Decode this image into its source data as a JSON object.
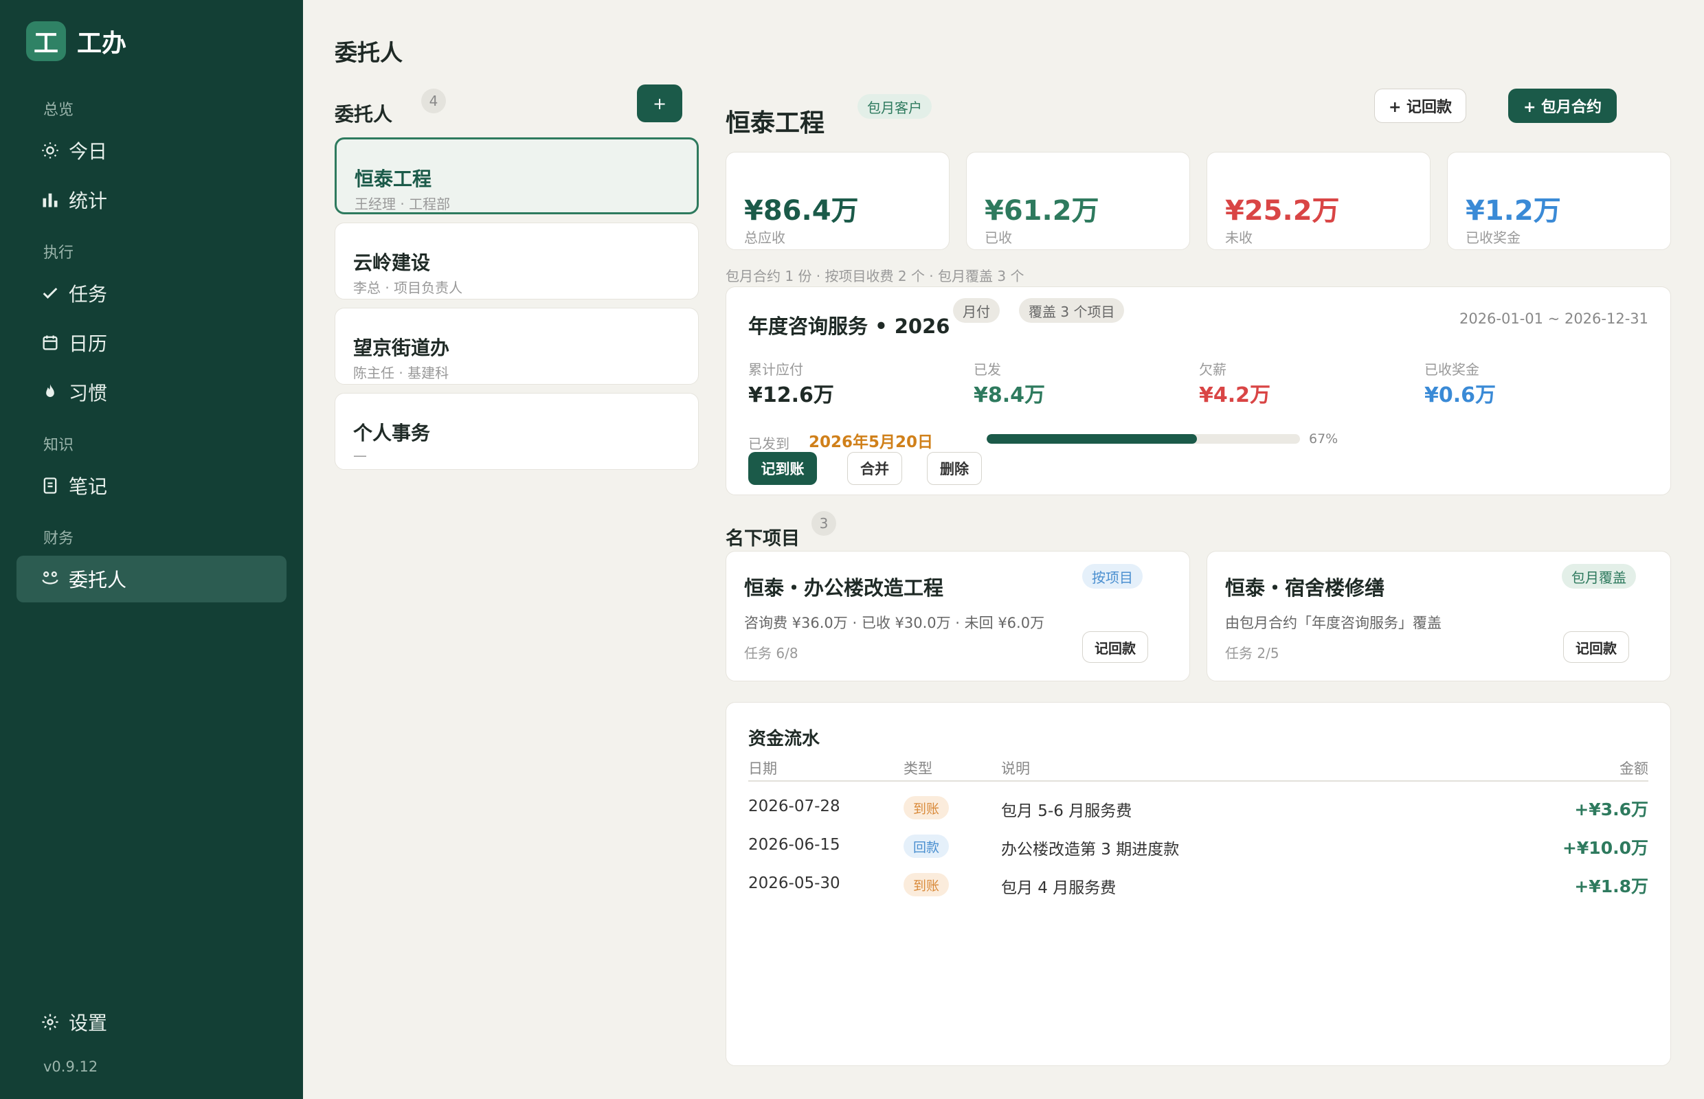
{
  "sidebar": {
    "brand_logo": "工",
    "brand_name": "工办",
    "sections": [
      "总览",
      "执行",
      "知识",
      "财务"
    ],
    "items": [
      {
        "label": "今日",
        "icon": "sun-icon"
      },
      {
        "label": "统计",
        "icon": "bar-chart-icon"
      },
      {
        "label": "任务",
        "icon": "check-icon"
      },
      {
        "label": "日历",
        "icon": "calendar-icon"
      },
      {
        "label": "习惯",
        "icon": "flame-icon"
      },
      {
        "label": "笔记",
        "icon": "note-icon"
      },
      {
        "label": "委托人",
        "icon": "people-icon",
        "active": true
      }
    ],
    "settings_label": "设置",
    "version": "v0.9.12"
  },
  "page_title": "委托人",
  "client_list": {
    "title": "委托人",
    "count": "4",
    "add_label": "+",
    "clients": [
      {
        "name": "恒泰工程",
        "sub": "王经理 · 工程部"
      },
      {
        "name": "云岭建设",
        "sub": "李总 · 项目负责人"
      },
      {
        "name": "望京街道办",
        "sub": "陈主任 · 基建科"
      },
      {
        "name": "个人事务",
        "sub": "—"
      }
    ]
  },
  "detail": {
    "name": "恒泰工程",
    "badge": "包月客户",
    "record_payment_label": "+ 记回款",
    "monthly_contract_label": "+ 包月合约",
    "stats": [
      {
        "value": "¥86.4万",
        "label": "总应收",
        "color": "#1b5a49"
      },
      {
        "value": "¥61.2万",
        "label": "已收",
        "color": "#2e7a5e"
      },
      {
        "value": "¥25.2万",
        "label": "未收",
        "color": "#d94545"
      },
      {
        "value": "¥1.2万",
        "label": "已收奖金",
        "color": "#3a8ad6"
      }
    ],
    "meta": "包月合约 1 份 · 按项目收费 2 个 · 包月覆盖 3 个"
  },
  "contract": {
    "title": "年度咨询服务 • 2026",
    "tag_monthly": "月付",
    "tag_coverage": "覆盖 3 个项目",
    "date_range": "2026-01-01 ~ 2026-12-31",
    "stats": [
      {
        "label": "累计应付",
        "value": "¥12.6万",
        "color": "#1f2a26"
      },
      {
        "label": "已发",
        "value": "¥8.4万",
        "color": "#2e7a5e"
      },
      {
        "label": "欠薪",
        "value": "¥4.2万",
        "color": "#d94545"
      },
      {
        "label": "已收奖金",
        "value": "¥0.6万",
        "color": "#3a8ad6"
      }
    ],
    "paid_to_label": "已发到",
    "paid_to_date": "2026年5月20日",
    "progress": 67,
    "progress_text": "67%",
    "actions": {
      "record": "记到账",
      "merge": "合并",
      "delete": "删除"
    }
  },
  "projects": {
    "title": "名下项目",
    "count": "3",
    "items": [
      {
        "name": "恒泰・办公楼改造工程",
        "tag": "按项目",
        "desc": "咨询费 ¥36.0万 · 已收 ¥30.0万 · 未回 ¥6.0万",
        "tasks": "任务 6/8",
        "action": "记回款"
      },
      {
        "name": "恒泰・宿舍楼修缮",
        "tag": "包月覆盖",
        "desc": "由包月合约「年度咨询服务」覆盖",
        "tasks": "任务 2/5",
        "action": "记回款"
      }
    ]
  },
  "ledger": {
    "title": "资金流水",
    "headers": {
      "date": "日期",
      "type": "类型",
      "desc": "说明",
      "amount": "金额"
    },
    "rows": [
      {
        "date": "2026-07-28",
        "type": "到账",
        "type_kind": "orange",
        "desc": "包月 5-6 月服务费",
        "amount": "+¥3.6万"
      },
      {
        "date": "2026-06-15",
        "type": "回款",
        "type_kind": "blue",
        "desc": "办公楼改造第 3 期进度款",
        "amount": "+¥10.0万"
      },
      {
        "date": "2026-05-30",
        "type": "到账",
        "type_kind": "orange",
        "desc": "包月 4 月服务费",
        "amount": "+¥1.8万"
      }
    ]
  }
}
